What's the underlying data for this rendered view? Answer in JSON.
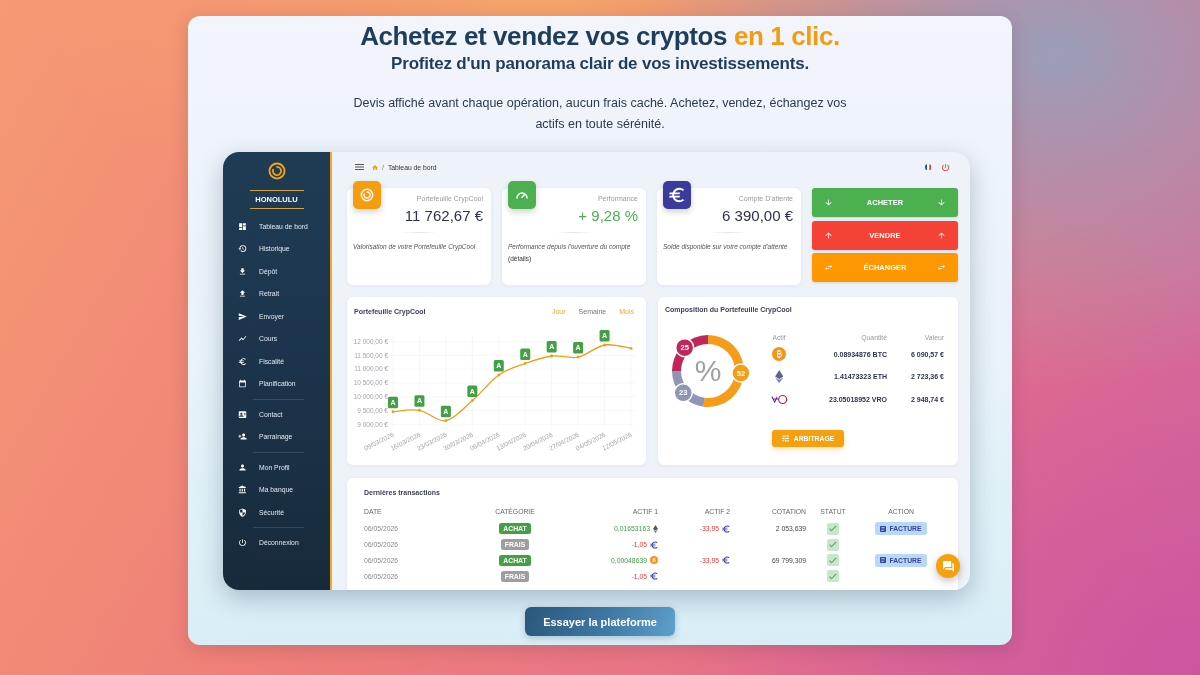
{
  "hero": {
    "headline": {
      "text": "Achetez et vendez vos cryptos",
      "highlight": "en 1 clic."
    },
    "subheadline": "Profitez d'un panorama clair de vos investissements.",
    "description": "Devis affiché avant chaque opération, aucun frais caché. Achetez, vendez, échangez vos actifs en toute sérénité."
  },
  "dashboard": {
    "sidebar": {
      "brand": "HONOLULU",
      "groups": [
        [
          "Tableau de bord",
          "Historique",
          "Dépôt",
          "Retrait",
          "Envoyer",
          "Cours",
          "Fiscalité",
          "Planification"
        ],
        [
          "Contact",
          "Parrainage"
        ],
        [
          "Mon Profil",
          "Ma banque",
          "Sécurité"
        ],
        [
          "Déconnexion"
        ]
      ]
    },
    "topbar": {
      "breadcrumb": {
        "separator": "/",
        "current": "Tableau de bord"
      }
    },
    "stat_cards": [
      {
        "label": "Portefeuille CrypCool",
        "value": "11 762,67 €",
        "description": "Valorisation de votre Portefeuille CrypCool",
        "color": "#f59c0f",
        "kind": "amount"
      },
      {
        "label": "Performance",
        "value": "+ 9,28 %",
        "description": "Performance depuis l'ouverture du compte",
        "link": "(détails)",
        "color": "#4caf50",
        "kind": "gain"
      },
      {
        "label": "Compte D'attente",
        "value": "6 390,00 €",
        "description": "Solde disponible sur votre compte d'attente",
        "color": "#3b3b9e",
        "kind": "amount"
      }
    ],
    "action_buttons": [
      {
        "label": "ACHETER",
        "kind": "buy"
      },
      {
        "label": "VENDRE",
        "kind": "sell"
      },
      {
        "label": "ÉCHANGER",
        "kind": "exchange"
      }
    ],
    "portfolio_chart": {
      "periods": [
        {
          "label": "Jour",
          "selected": true
        },
        {
          "label": "Semaine",
          "selected": false
        },
        {
          "label": "Mois",
          "selected": true
        }
      ],
      "chart_data": {
        "type": "line",
        "title": "Portefeuille CrypCool",
        "categories": [
          "09/03/2026",
          "16/03/2026",
          "23/03/2026",
          "30/03/2026",
          "06/04/2026",
          "13/04/2026",
          "20/04/2026",
          "27/04/2026",
          "04/05/2026",
          "12/05/2026"
        ],
        "series": [
          {
            "color": "#f39c12",
            "values": [
              9460,
              9510,
              9130,
              9860,
              10790,
              11210,
              11480,
              11440,
              11880,
              11760
            ]
          }
        ],
        "ylim": [
          9000,
          12000
        ],
        "yticks": [
          {
            "value": 9000,
            "label": "9 000,00 €"
          },
          {
            "value": 9500,
            "label": "9 500,00 €"
          },
          {
            "value": 10000,
            "label": "10 000,00 €"
          },
          {
            "value": 10500,
            "label": "10 500,00 €"
          },
          {
            "value": 11000,
            "label": "11 000,00 €"
          },
          {
            "value": 11500,
            "label": "11 500,00 €"
          },
          {
            "value": 12000,
            "label": "12 000,00 €"
          }
        ],
        "grid": true,
        "annotations": [
          {
            "x": "09/03/2026",
            "text": "A"
          },
          {
            "x": "16/03/2026",
            "text": "A"
          },
          {
            "x": "23/03/2026",
            "text": "A"
          },
          {
            "x": "30/03/2026",
            "text": "A"
          },
          {
            "x": "06/04/2026",
            "text": "A"
          },
          {
            "x": "13/04/2026",
            "text": "A"
          },
          {
            "x": "20/04/2026",
            "text": "A"
          },
          {
            "x": "27/04/2026",
            "text": "A"
          },
          {
            "x": "04/05/2026",
            "text": "A"
          }
        ]
      }
    },
    "composition": {
      "title": "Composition du Portefeuille CrypCool",
      "chart_data": {
        "type": "donut",
        "values": [
          52,
          23,
          25
        ],
        "colors": [
          "#f59c1a",
          "#8e95b5",
          "#c2255c"
        ],
        "value_labels": [
          "52",
          "23",
          "25"
        ],
        "annotations": [
          {
            "text": "%"
          }
        ]
      },
      "columns": [
        "Actif",
        "Quantité",
        "Valeur"
      ],
      "rows": [
        {
          "kind": "btc",
          "quantity": "0.08934876 BTC",
          "value": "6 090,57 €"
        },
        {
          "kind": "eth",
          "quantity": "1.41473323 ETH",
          "value": "2 723,36 €"
        },
        {
          "kind": "vro",
          "quantity": "23.05018952 VRO",
          "value": "2 948,74 €"
        }
      ],
      "button": "ARBITRAGE"
    },
    "transactions": {
      "title": "Dernières transactions",
      "columns": [
        "DATE",
        "CATÉGORIE",
        "ACTIF 1",
        "ACTIF 2",
        "COTATION",
        "STATUT",
        "ACTION"
      ],
      "rows": [
        {
          "date": "06/05/2026",
          "category": {
            "label": "ACHAT",
            "color": "#43a047"
          },
          "asset_1": {
            "amount": "0,01653163",
            "kind": "eth",
            "credit": true
          },
          "asset_2": {
            "amount": "-33,95",
            "kind": "eur",
            "credit": false
          },
          "quote": "2 053,639",
          "done": true,
          "action": "FACTURE"
        },
        {
          "date": "06/05/2026",
          "category": {
            "label": "FRAIS",
            "color": "#9e9e9e"
          },
          "asset_1": {
            "amount": "-1,05",
            "kind": "eur",
            "credit": false
          },
          "done": true
        },
        {
          "date": "06/05/2026",
          "category": {
            "label": "ACHAT",
            "color": "#43a047"
          },
          "asset_1": {
            "amount": "0,00048639",
            "kind": "btc",
            "credit": true
          },
          "asset_2": {
            "amount": "-33,95",
            "kind": "eur",
            "credit": false
          },
          "quote": "69 799,309",
          "done": true,
          "action": "FACTURE"
        },
        {
          "date": "06/05/2026",
          "category": {
            "label": "FRAIS",
            "color": "#9e9e9e"
          },
          "asset_1": {
            "amount": "-1,05",
            "kind": "eur",
            "credit": false
          },
          "done": true
        }
      ]
    }
  },
  "cta_button": "Essayer la plateforme"
}
